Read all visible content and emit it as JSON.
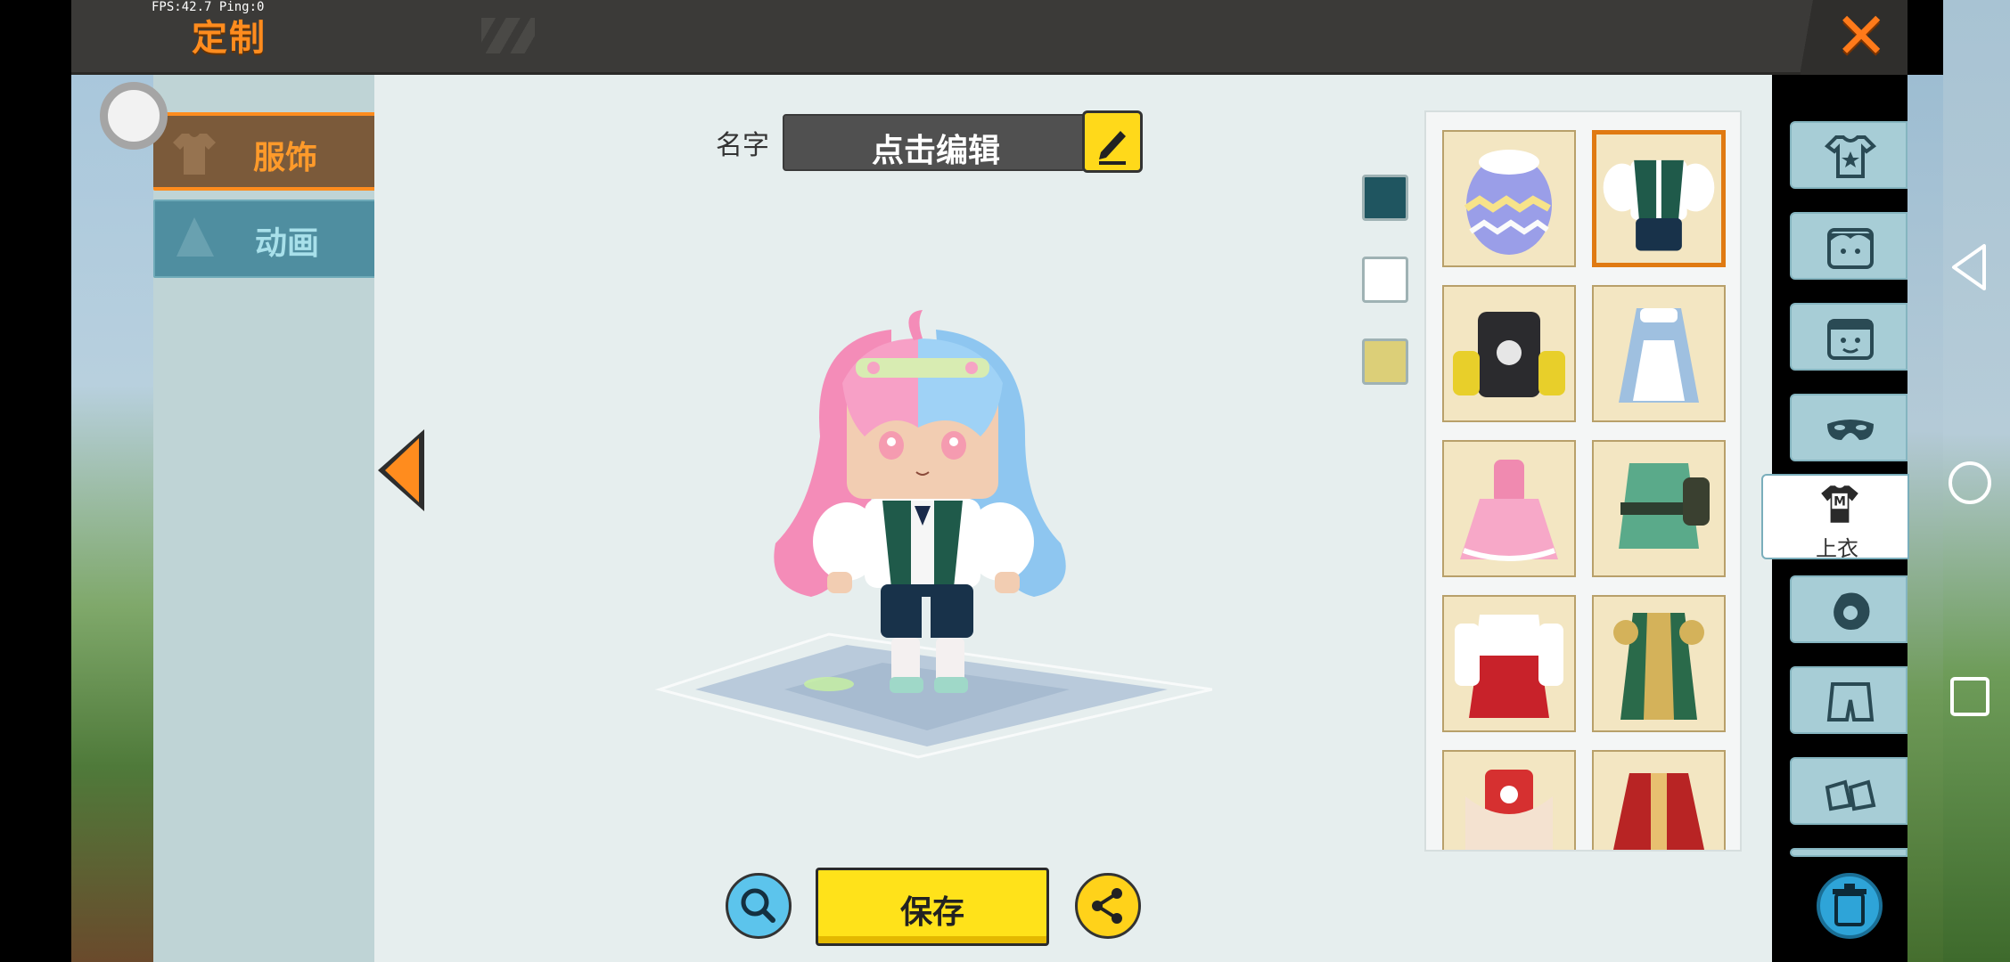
{
  "hud": {
    "fps_text": "FPS:42.7  Ping:0"
  },
  "header": {
    "title": "定制",
    "close_label": "✕"
  },
  "left_tabs": [
    {
      "label": "服饰",
      "active": true
    },
    {
      "label": "动画",
      "active": false
    }
  ],
  "name_field": {
    "label": "名字",
    "value": "点击编辑"
  },
  "colors": {
    "swatches": [
      "#1f5560",
      "#ffffff",
      "#dccf78"
    ],
    "accent": "#ff8c1e",
    "save": "#ffe21a"
  },
  "items": [
    {
      "name": "Easter egg outfit",
      "selected": false
    },
    {
      "name": "Green vest with white shirt",
      "selected": true
    },
    {
      "name": "Black hoodie with yellow sleeves",
      "selected": false
    },
    {
      "name": "Blue maid dress",
      "selected": false
    },
    {
      "name": "Pink frilly dress",
      "selected": false
    },
    {
      "name": "Green armored outfit",
      "selected": false
    },
    {
      "name": "Red and white shrine outfit",
      "selected": false
    },
    {
      "name": "Green and gold royal robe",
      "selected": false
    },
    {
      "name": "Red festive outfit",
      "selected": false
    },
    {
      "name": "Red ornate robe",
      "selected": false
    }
  ],
  "categories": [
    {
      "icon": "onesie-icon",
      "label": ""
    },
    {
      "icon": "hair-face-icon",
      "label": ""
    },
    {
      "icon": "face-icon",
      "label": ""
    },
    {
      "icon": "mask-icon",
      "label": ""
    },
    {
      "icon": "shirt-icon",
      "label": "上衣",
      "active": true
    },
    {
      "icon": "gloves-icon",
      "label": ""
    },
    {
      "icon": "pants-icon",
      "label": ""
    },
    {
      "icon": "shoes-icon",
      "label": ""
    }
  ],
  "actions": {
    "save_label": "保存"
  }
}
